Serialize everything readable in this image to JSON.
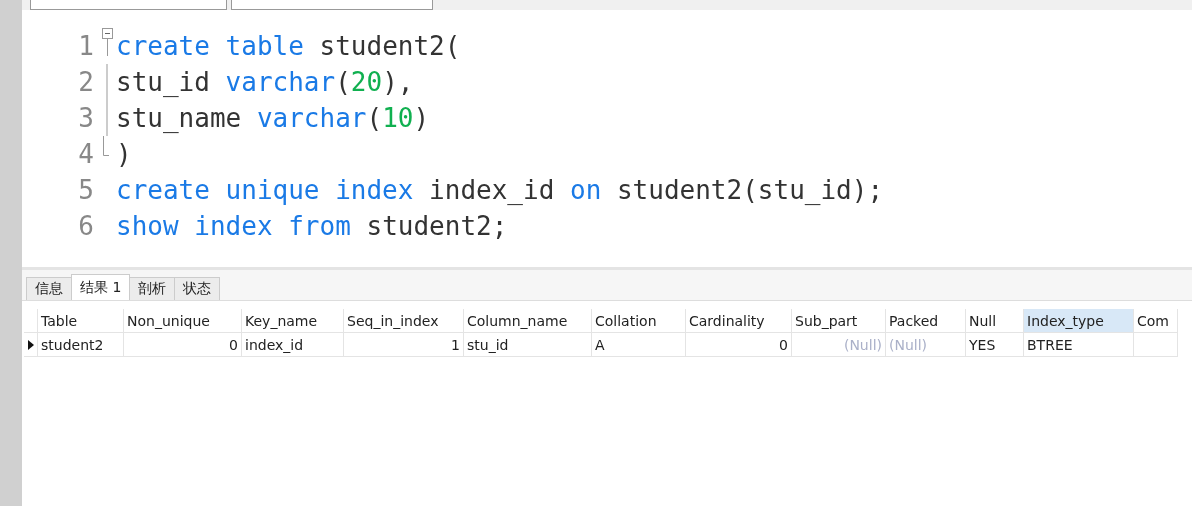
{
  "editor": {
    "lines": [
      {
        "number": "1",
        "fold_start": true,
        "in_fold": false,
        "fold_end": false,
        "tokens": [
          {
            "text": "create ",
            "kind": "keyword"
          },
          {
            "text": "table",
            "kind": "keyword"
          },
          {
            "text": " student2(",
            "kind": "plain"
          }
        ]
      },
      {
        "number": "2",
        "fold_start": false,
        "in_fold": true,
        "fold_end": false,
        "tokens": [
          {
            "text": "stu_id ",
            "kind": "plain"
          },
          {
            "text": "varchar",
            "kind": "keyword"
          },
          {
            "text": "(",
            "kind": "plain"
          },
          {
            "text": "20",
            "kind": "number"
          },
          {
            "text": "),",
            "kind": "plain"
          }
        ]
      },
      {
        "number": "3",
        "fold_start": false,
        "in_fold": true,
        "fold_end": false,
        "tokens": [
          {
            "text": "stu_name ",
            "kind": "plain"
          },
          {
            "text": "varchar",
            "kind": "keyword"
          },
          {
            "text": "(",
            "kind": "plain"
          },
          {
            "text": "10",
            "kind": "number"
          },
          {
            "text": ")",
            "kind": "plain"
          }
        ]
      },
      {
        "number": "4",
        "fold_start": false,
        "in_fold": false,
        "fold_end": true,
        "tokens": [
          {
            "text": ")",
            "kind": "plain"
          }
        ]
      },
      {
        "number": "5",
        "fold_start": false,
        "in_fold": false,
        "fold_end": false,
        "tokens": [
          {
            "text": "create ",
            "kind": "keyword"
          },
          {
            "text": "unique ",
            "kind": "keyword"
          },
          {
            "text": "index",
            "kind": "keyword"
          },
          {
            "text": " index_id ",
            "kind": "plain"
          },
          {
            "text": "on",
            "kind": "keyword"
          },
          {
            "text": " student2(stu_id);",
            "kind": "plain"
          }
        ]
      },
      {
        "number": "6",
        "fold_start": false,
        "in_fold": false,
        "fold_end": false,
        "tokens": [
          {
            "text": "show ",
            "kind": "keyword"
          },
          {
            "text": "index ",
            "kind": "keyword"
          },
          {
            "text": "from",
            "kind": "keyword"
          },
          {
            "text": " student2;",
            "kind": "plain"
          }
        ]
      }
    ]
  },
  "tabs": [
    {
      "label": "信息",
      "selected": false
    },
    {
      "label": "结果 1",
      "selected": true
    },
    {
      "label": "剖析",
      "selected": false
    },
    {
      "label": "状态",
      "selected": false
    }
  ],
  "table": {
    "columns": [
      {
        "label": "Table",
        "kind": "text",
        "selected": false
      },
      {
        "label": "Non_unique",
        "kind": "number",
        "selected": false
      },
      {
        "label": "Key_name",
        "kind": "text",
        "selected": false
      },
      {
        "label": "Seq_in_index",
        "kind": "number",
        "selected": false
      },
      {
        "label": "Column_name",
        "kind": "text",
        "selected": false
      },
      {
        "label": "Collation",
        "kind": "text",
        "selected": false
      },
      {
        "label": "Cardinality",
        "kind": "number",
        "selected": false
      },
      {
        "label": "Sub_part",
        "kind": "number",
        "selected": false
      },
      {
        "label": "Packed",
        "kind": "text",
        "selected": false
      },
      {
        "label": "Null",
        "kind": "text",
        "selected": false
      },
      {
        "label": "Index_type",
        "kind": "text",
        "selected": true
      },
      {
        "label": "Com",
        "selected": false
      }
    ],
    "rows": [
      {
        "selected": true,
        "cells": [
          {
            "text": "student2",
            "null": false
          },
          {
            "text": "0",
            "null": false
          },
          {
            "text": "index_id",
            "null": false
          },
          {
            "text": "1",
            "null": false
          },
          {
            "text": "stu_id",
            "null": false
          },
          {
            "text": "A",
            "null": false
          },
          {
            "text": "0",
            "null": false
          },
          {
            "text": "(Null)",
            "null": true
          },
          {
            "text": "(Null)",
            "null": true
          },
          {
            "text": "YES",
            "null": false
          },
          {
            "text": "BTREE",
            "null": false
          }
        ]
      }
    ]
  }
}
